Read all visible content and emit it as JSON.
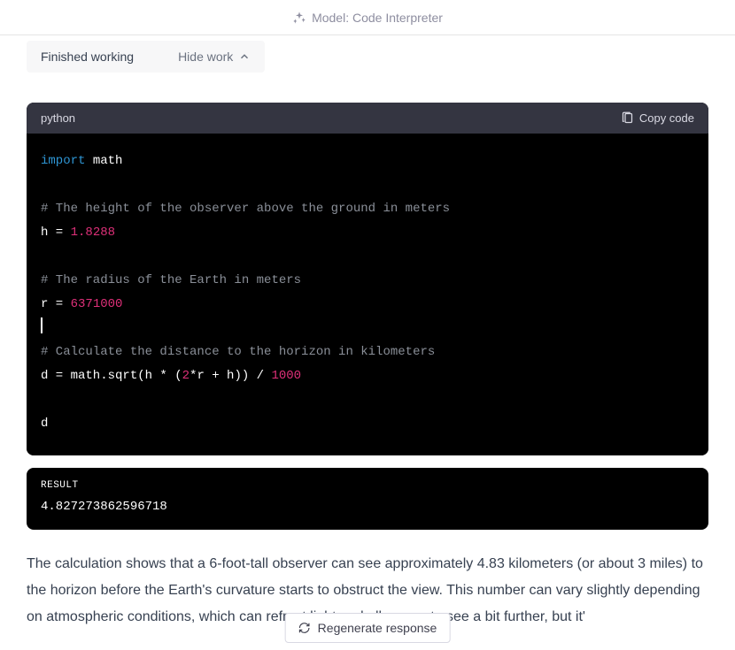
{
  "header": {
    "model_label": "Model: Code Interpreter"
  },
  "status": {
    "label": "Finished working",
    "toggle": "Hide work"
  },
  "code": {
    "language": "python",
    "copy_label": "Copy code",
    "tokens": {
      "kw_import": "import",
      "id_math": " math",
      "cm1": "# The height of the observer above the ground in meters",
      "l3a": "h = ",
      "l3b": "1.8288",
      "cm2": "# The radius of the Earth in meters",
      "l5a": "r = ",
      "l5b": "6371000",
      "cm3": "# Calculate the distance to the horizon in kilometers",
      "l7a": "d = math.sqrt(h * (",
      "l7b": "2",
      "l7c": "*r + h)) / ",
      "l7d": "1000",
      "l8": "d"
    }
  },
  "result": {
    "label": "RESULT",
    "value": "4.827273862596718"
  },
  "answer": {
    "text": "The calculation shows that a 6-foot-tall observer can see approximately 4.83 kilometers (or about 3 miles) to the horizon before the Earth's curvature starts to obstruct the view. This number can vary slightly depending on atmospheric conditions, which can refract light and allow you to see a bit further, but it'"
  },
  "regenerate": {
    "label": "Regenerate response"
  }
}
